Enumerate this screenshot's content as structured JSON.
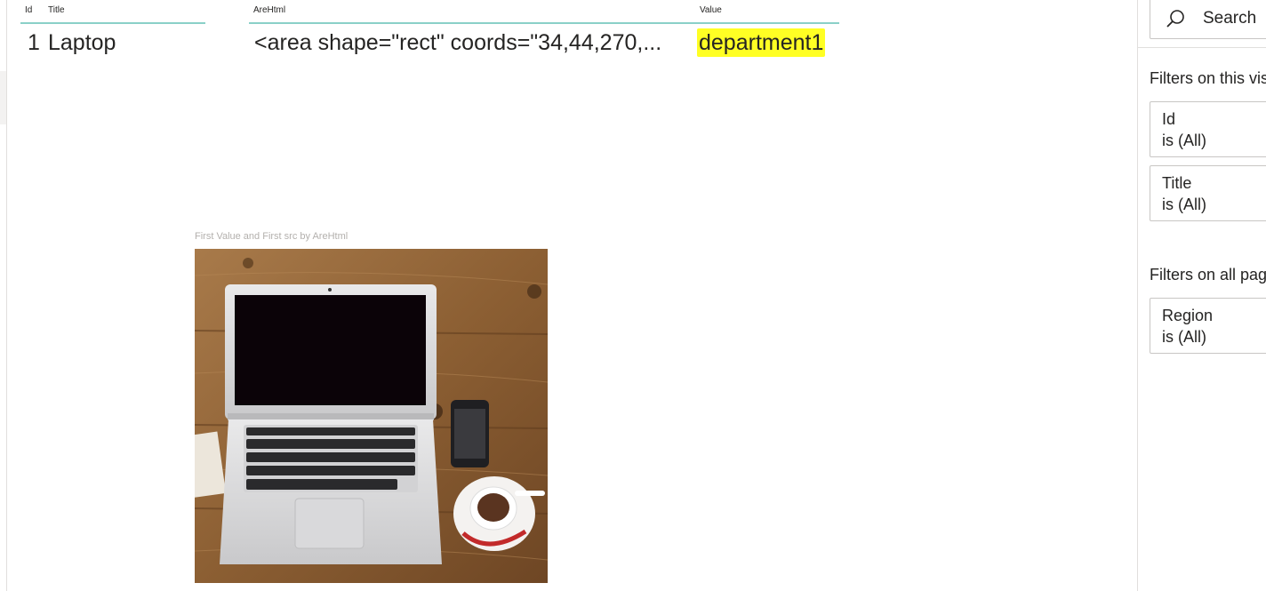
{
  "table": {
    "headers": [
      "Id",
      "Title",
      "AreHtml",
      "Value"
    ],
    "row": {
      "id": "1",
      "title": "Laptop",
      "arehtml": "<area shape=\"rect\" coords=\"34,44,270,...",
      "value": "department1"
    },
    "highlight_color": "#ffff24",
    "header_line_color": "#8ad0c8"
  },
  "image_visual": {
    "title": "First Value and First src by AreHtml",
    "image_icon": "laptop-on-desk-photo"
  },
  "filters_pane": {
    "search_label": "Search",
    "search_icon": "search-icon",
    "visual_section_title": "Filters on this vis",
    "visual_filters": [
      {
        "name": "Id",
        "state": "is (All)"
      },
      {
        "name": "Title",
        "state": "is (All)"
      }
    ],
    "page_section_title": "Filters on all pag",
    "page_filters": [
      {
        "name": "Region",
        "state": "is (All)"
      }
    ]
  }
}
